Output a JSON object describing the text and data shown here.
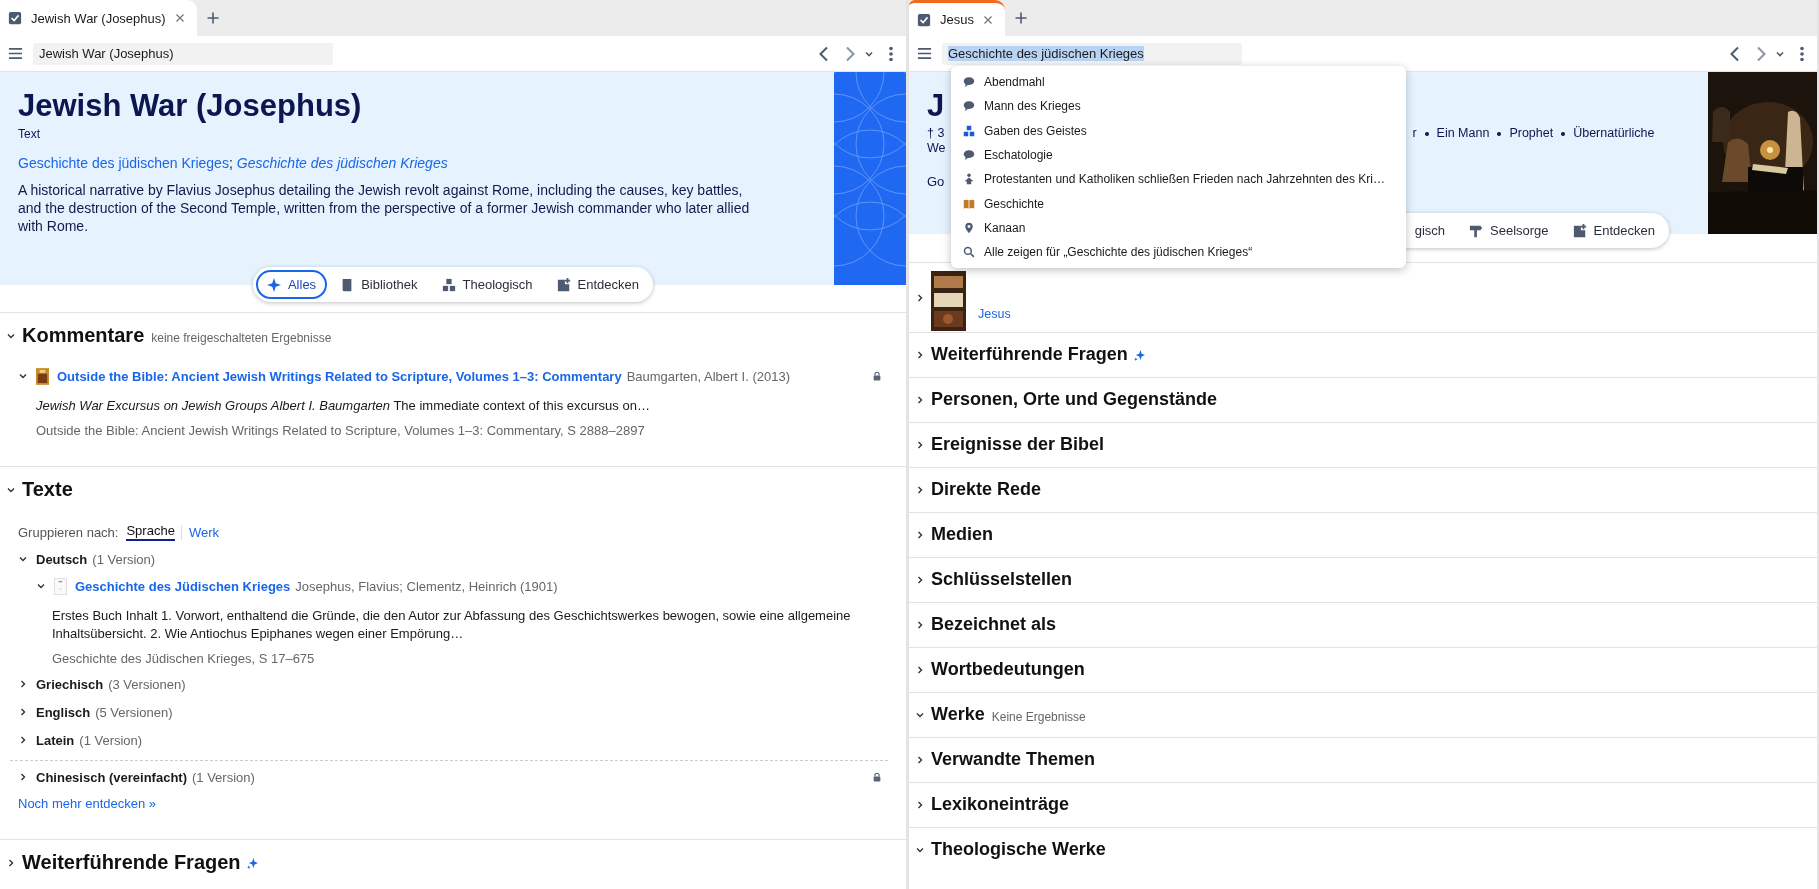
{
  "left_pane": {
    "tab": {
      "label": "Jewish War (Josephus)",
      "highlighted": false
    },
    "address": {
      "value": "Jewish War (Josephus)",
      "text_selected": false
    },
    "header": {
      "title": "Jewish War (Josephus)",
      "subtitle": "Text",
      "links": [
        {
          "text": "Geschichte des jüdischen Krieges",
          "italic": false
        },
        {
          "text": "Geschichte des jüdischen Krieges",
          "italic": true
        }
      ],
      "link_separator": ";",
      "description": "A historical narrative by Flavius Josephus detailing the Jewish revolt against Rome, including the causes, key battles, and the destruction of the Second Temple, written from the perspective of a former Jewish commander who later allied with Rome."
    },
    "filters": [
      {
        "label": "Alles",
        "kind": "sparkle",
        "selected": true
      },
      {
        "label": "Bibliothek",
        "kind": "book",
        "selected": false
      },
      {
        "label": "Theologisch",
        "kind": "blocks",
        "selected": false
      },
      {
        "label": "Entdecken",
        "kind": "discover",
        "selected": false
      }
    ],
    "sections": [
      {
        "kind": "commentary",
        "title": "Kommentare",
        "note": "keine freigeschalteten Ergebnisse",
        "expanded": true,
        "items": [
          {
            "title": "Outside the Bible: Ancient Jewish Writings Related to Scripture, Volumes 1–3: Commentary",
            "byline": "Baumgarten, Albert I. (2013)",
            "excerpt": "*Jewish War Excursus on Jewish Groups Albert I. Baumgarten* The immediate context of this excursus on…",
            "source": "Outside the Bible: Ancient Jewish Writings Related to Scripture, Volumes 1–3: Commentary, S 2888–2897",
            "locked": true,
            "expanded": true
          }
        ]
      },
      {
        "kind": "texts",
        "title": "Texte",
        "expanded": true,
        "group_label": "Gruppieren nach:",
        "group_options": [
          {
            "label": "Sprache",
            "selected": true
          },
          {
            "label": "Werk",
            "selected": false
          }
        ],
        "languages": [
          {
            "name": "Deutsch",
            "count": "(1 Version)",
            "expanded": true,
            "locked": false,
            "separated": false,
            "children": [
              {
                "title": "Geschichte des Jüdischen Krieges",
                "byline": "Josephus, Flavius; Clementz, Heinrich (1901)",
                "excerpt": "Erstes Buch Inhalt 1. Vorwort, enthaltend die Gründe, die den Autor zur Abfassung des Geschichtswerkes bewogen, sowie eine allgemeine Inhaltsübersicht. 2. Wie Antiochus Epiphanes wegen einer Empörung…",
                "source": "Geschichte des Jüdischen Krieges, S 17–675",
                "locked": false,
                "expanded": true
              }
            ]
          },
          {
            "name": "Griechisch",
            "count": "(3 Versionen)",
            "expanded": false,
            "locked": false,
            "separated": false
          },
          {
            "name": "Englisch",
            "count": "(5 Versionen)",
            "expanded": false,
            "locked": false,
            "separated": false
          },
          {
            "name": "Latein",
            "count": "(1 Version)",
            "expanded": false,
            "locked": false,
            "separated": false
          },
          {
            "name": "Chinesisch (vereinfacht)",
            "count": "(1 Version)",
            "expanded": false,
            "locked": true,
            "separated": true
          }
        ],
        "more_link": "Noch mehr entdecken »"
      },
      {
        "kind": "plain",
        "title": "Weiterführende Fragen",
        "ai": true,
        "expanded": false
      }
    ]
  },
  "right_pane": {
    "tab": {
      "label": "Jesus",
      "highlighted": true
    },
    "address": {
      "value": "Geschichte des jüdischen Krieges",
      "text_selected": true
    },
    "header": {
      "title": "J",
      "meta_line": [
        {
          "text": "† 3"
        },
        {
          "text": "r",
          "gap_before": true
        },
        {
          "text": "Ein Mann",
          "bullet_before": true
        },
        {
          "text": "Prophet",
          "bullet_before": true
        },
        {
          "text": "Übernatürliche",
          "bullet_before": true
        }
      ],
      "meta_line_2": "We",
      "description": "Go"
    },
    "filters": [
      {
        "label": "gisch",
        "kind": "plain",
        "selected": false
      },
      {
        "label": "Seelsorge",
        "kind": "signpost",
        "selected": false
      },
      {
        "label": "Entdecken",
        "kind": "discover",
        "selected": false
      }
    ],
    "first_result": {
      "link": "Jesus"
    },
    "sections": [
      {
        "title": "Weiterführende Fragen",
        "ai": true,
        "expanded": false
      },
      {
        "title": "Personen, Orte und Gegenstände",
        "expanded": false
      },
      {
        "title": "Ereignisse der Bibel",
        "expanded": false
      },
      {
        "title": "Direkte Rede",
        "expanded": false
      },
      {
        "title": "Medien",
        "expanded": false
      },
      {
        "title": "Schlüsselstellen",
        "expanded": false
      },
      {
        "title": "Bezeichnet als",
        "expanded": false
      },
      {
        "title": "Wortbedeutungen",
        "expanded": false
      },
      {
        "title": "Werke",
        "note": "Keine Ergebnisse",
        "expanded": true
      },
      {
        "title": "Verwandte Themen",
        "expanded": false
      },
      {
        "title": "Lexikoneinträge",
        "expanded": false
      },
      {
        "title": "Theologische Werke",
        "expanded": true
      }
    ],
    "suggestions": [
      {
        "label": "Abendmahl",
        "kind": "speech"
      },
      {
        "label": "Mann des Krieges",
        "kind": "speech"
      },
      {
        "label": "Gaben des Geistes",
        "kind": "blocks"
      },
      {
        "label": "Eschatologie",
        "kind": "speech"
      },
      {
        "label": "Protestanten und Katholiken schließen Frieden nach Jahrzehnten des Kri…",
        "kind": "figure"
      },
      {
        "label": "Geschichte",
        "kind": "book"
      },
      {
        "label": "Kanaan",
        "kind": "pin"
      },
      {
        "label": "Alle zeigen für „Geschichte des jüdischen Krieges“",
        "kind": "search"
      }
    ]
  }
}
